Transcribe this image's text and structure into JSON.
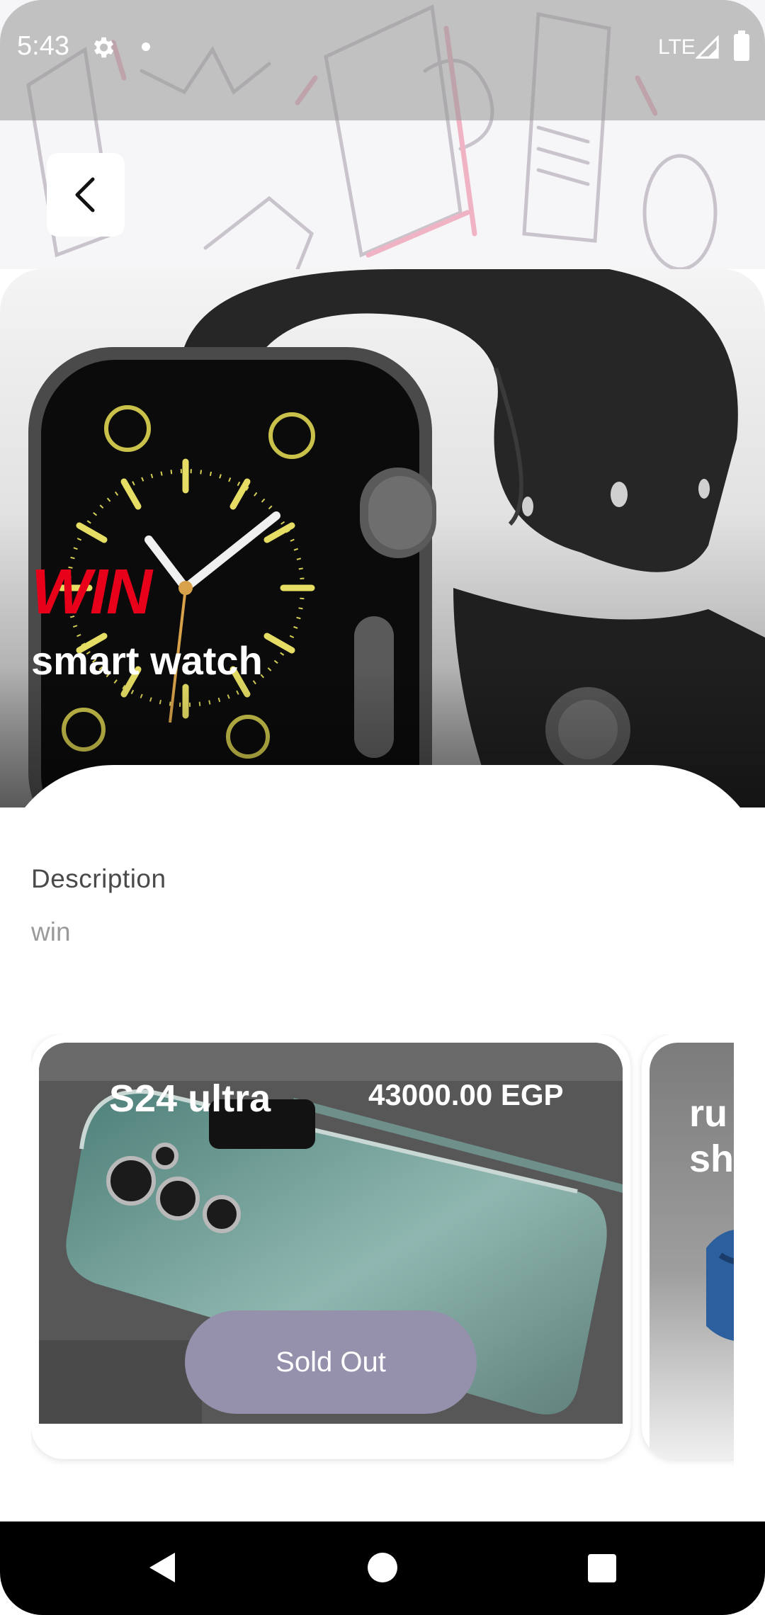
{
  "status_bar": {
    "time": "5:43",
    "network": "LTE",
    "icons": [
      "gear-icon",
      "notification-dot-icon",
      "signal-icon",
      "battery-icon"
    ]
  },
  "header": {
    "back_icon": "chevron-left-icon"
  },
  "hero": {
    "badge": "WIN",
    "title": "smart watch"
  },
  "description": {
    "title": "Description",
    "body": "win"
  },
  "products": [
    {
      "name": "S24 ultra",
      "price": "43000.00 EGP",
      "action_label": "Sold Out"
    },
    {
      "name": "ru\nsh"
    }
  ],
  "nav_bar": {
    "icons": [
      "back-triangle-icon",
      "home-circle-icon",
      "recents-square-icon"
    ]
  },
  "colors": {
    "accent_red": "#e8001a",
    "sold_out_button": "#9590ab",
    "nav_background": "#000000"
  }
}
